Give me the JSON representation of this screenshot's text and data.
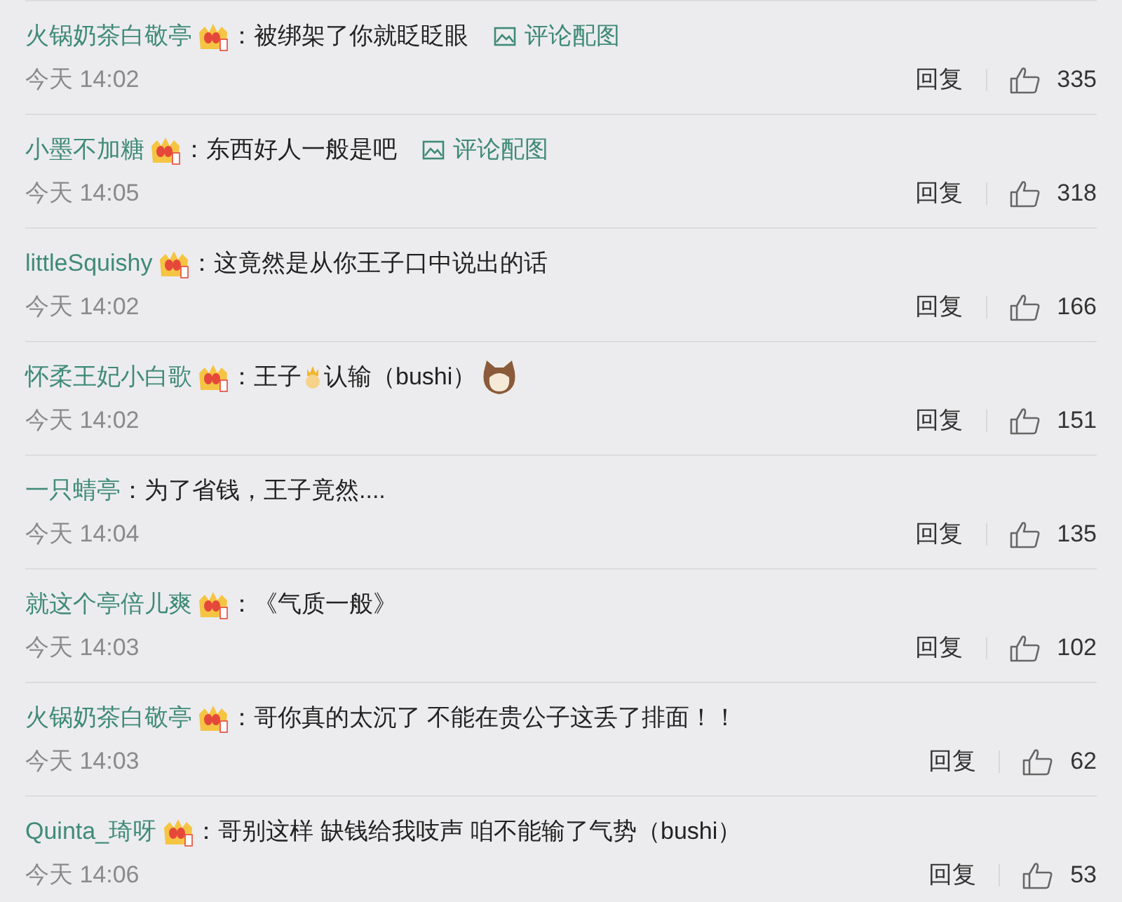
{
  "comments": [
    {
      "user": "火锅奶茶白敬亭",
      "badge": true,
      "parts": [
        {
          "kind": "text",
          "text": "：被绑架了你就眨眨眼"
        }
      ],
      "image_link": "评论配图",
      "time": "今天 14:02",
      "reply": "回复",
      "likes": "335"
    },
    {
      "user": "小墨不加糖",
      "badge": true,
      "parts": [
        {
          "kind": "text",
          "text": "：东西好人一般是吧"
        }
      ],
      "image_link": "评论配图",
      "time": "今天 14:05",
      "reply": "回复",
      "likes": "318"
    },
    {
      "user": "littleSquishy",
      "badge": true,
      "parts": [
        {
          "kind": "text",
          "text": "：这竟然是从你王子口中说出的话"
        }
      ],
      "time": "今天 14:02",
      "reply": "回复",
      "likes": "166"
    },
    {
      "user": "怀柔王妃小白歌",
      "badge": true,
      "parts": [
        {
          "kind": "text",
          "text": "：王子"
        },
        {
          "kind": "prince"
        },
        {
          "kind": "text",
          "text": " 认输（bushi）"
        },
        {
          "kind": "cat"
        }
      ],
      "time": "今天 14:02",
      "reply": "回复",
      "likes": "151"
    },
    {
      "user": "一只蜻亭",
      "badge": false,
      "parts": [
        {
          "kind": "text",
          "text": "：为了省钱，王子竟然...."
        }
      ],
      "time": "今天 14:04",
      "reply": "回复",
      "likes": "135"
    },
    {
      "user": "就这个亭倍儿爽",
      "badge": true,
      "parts": [
        {
          "kind": "text",
          "text": "：《气质一般》"
        }
      ],
      "time": "今天 14:03",
      "reply": "回复",
      "likes": "102"
    },
    {
      "user": "火锅奶茶白敬亭",
      "badge": true,
      "parts": [
        {
          "kind": "text",
          "text": "：哥你真的太沉了 不能在贵公子这丢了排面！！"
        }
      ],
      "time": "今天 14:03",
      "reply": "回复",
      "likes": "62"
    },
    {
      "user": "Quinta_琦呀",
      "badge": true,
      "parts": [
        {
          "kind": "text",
          "text": "：哥别这样 缺钱给我吱声 咱不能输了气势（bushi）"
        }
      ],
      "time": "今天 14:06",
      "reply": "回复",
      "likes": "53"
    }
  ]
}
